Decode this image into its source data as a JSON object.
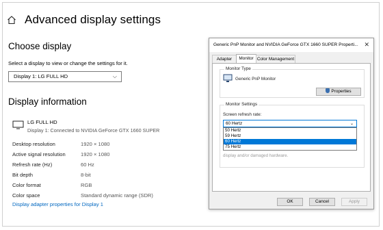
{
  "page": {
    "title": "Advanced display settings",
    "choose_display": {
      "heading": "Choose display",
      "instruction": "Select a display to view or change the settings for it.",
      "selected": "Display 1: LG FULL HD"
    },
    "display_info": {
      "heading": "Display information",
      "monitor_name": "LG FULL HD",
      "monitor_sub": "Display 1: Connected to NVIDIA GeForce GTX 1660 SUPER",
      "rows": [
        {
          "label": "Desktop resolution",
          "value": "1920 × 1080"
        },
        {
          "label": "Active signal resolution",
          "value": "1920 × 1080"
        },
        {
          "label": "Refresh rate (Hz)",
          "value": "60 Hz"
        },
        {
          "label": "Bit depth",
          "value": "8-bit"
        },
        {
          "label": "Color format",
          "value": "RGB"
        },
        {
          "label": "Color space",
          "value": "Standard dynamic range (SDR)"
        }
      ],
      "link": "Display adapter properties for Display 1"
    }
  },
  "dialog": {
    "title": "Generic PnP Monitor and NVIDIA GeForce GTX 1660 SUPER Properti...",
    "close_glyph": "✕",
    "tabs": [
      "Adapter",
      "Monitor",
      "Color Management"
    ],
    "active_tab": "Monitor",
    "monitor_type": {
      "label": "Monitor Type",
      "name": "Generic PnP Monitor",
      "properties_button": "Properties"
    },
    "monitor_settings": {
      "label": "Monitor Settings",
      "refresh_label": "Screen refresh rate:",
      "selected": "60 Hertz",
      "options": [
        "50 Hertz",
        "59 Hertz",
        "60 Hertz",
        "75 Hertz"
      ],
      "hidden_text": "display and/or damaged hardware."
    },
    "buttons": {
      "ok": "OK",
      "cancel": "Cancel",
      "apply": "Apply"
    }
  }
}
